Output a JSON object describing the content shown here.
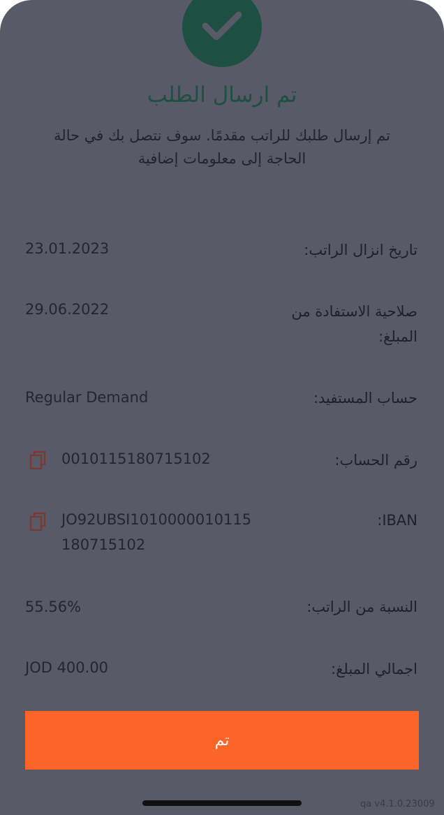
{
  "title": "تم ارسال الطلب",
  "message": "تم إرسال طلبك للراتب مقدمًا. سوف نتصل بك في حالة الحاجة إلى معلومات إضافية",
  "details": [
    {
      "label": "تاريخ انزال الراتب:",
      "value": "23.01.2023"
    },
    {
      "label": "صلاحية الاستفادة من المبلغ:",
      "value": "29.06.2022"
    },
    {
      "label": "حساب المستفيد:",
      "value": "Regular Demand"
    },
    {
      "label": "رقم الحساب:",
      "value": "0010115180715102"
    },
    {
      "label": "IBAN:",
      "value": "JO92UBSI1010000010115180715102"
    },
    {
      "label": "النسبة من الراتب:",
      "value": "55.56%"
    },
    {
      "label": "اجمالي المبلغ:",
      "value": "JOD 400.00"
    }
  ],
  "done_button": "تم",
  "version": "qa v4.1.0.23009",
  "icons": {
    "success": "checkmark-icon",
    "copy": "copy-icon"
  },
  "colors": {
    "overlay": "#595a67",
    "success_green": "#1e5042",
    "button_orange": "#fd6427",
    "copy_icon": "#7a3a34"
  }
}
